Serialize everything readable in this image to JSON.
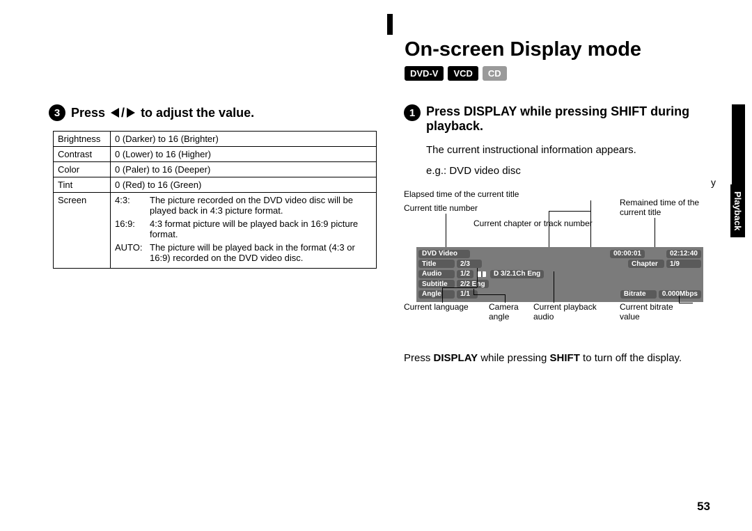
{
  "heading": "On-screen Display mode",
  "badges": {
    "dvd": "DVD-V",
    "vcd": "VCD",
    "cd": "CD"
  },
  "sideTab": "Playback",
  "pageNumber": "53",
  "left": {
    "stepNum": "3",
    "stepTextA": "Press",
    "stepTextB": "to adjust the value.",
    "rows": {
      "brightness_k": "Brightness",
      "brightness_v": "0 (Darker) to 16 (Brighter)",
      "contrast_k": "Contrast",
      "contrast_v": "0 (Lower) to 16 (Higher)",
      "color_k": "Color",
      "color_v": "0 (Paler) to 16 (Deeper)",
      "tint_k": "Tint",
      "tint_v": "0 (Red) to 16 (Green)",
      "screen_k": "Screen",
      "screen_43m": "4:3:",
      "screen_43v": "The picture recorded on the DVD video disc will be played back in 4:3 picture format.",
      "screen_169m": "16:9:",
      "screen_169v": "4:3 format picture will be played back in 16:9 picture format.",
      "screen_autom": "AUTO:",
      "screen_autov": "The picture will be played back in the format (4:3 or 16:9) recorded on the DVD video disc."
    }
  },
  "right": {
    "stepNum": "1",
    "stepText": "Press DISPLAY while pressing SHIFT during playback.",
    "para1": "The current instructional information appears.",
    "para2": "e.g.: DVD video disc",
    "willGo": "y",
    "callouts": {
      "ctn": "Current title number",
      "elapsed": "Elapsed time of the current title",
      "remained": "Remained time of the current title",
      "chap": "Current chapter or track number",
      "lang": "Current language",
      "angle": "Camera angle",
      "audio": "Current playback audio",
      "bitrate": "Current bitrate value"
    },
    "osd": {
      "disc": "DVD Video",
      "title_l": "Title",
      "title_v": "2/3",
      "chapter_l": "Chapter",
      "chapter_v": "1/9",
      "elapsed": "00:00:01",
      "remained": "02:12:40",
      "audio_l": "Audio",
      "audio_v1": "1/2",
      "audio_v2": "D 3/2.1Ch Eng",
      "sub_l": "Subtitle",
      "sub_v": "2/2 Eng",
      "angle_l": "Angle",
      "angle_v": "1/1",
      "bitrate_l": "Bitrate",
      "bitrate_v": "0.000Mbps"
    },
    "offA": "Press ",
    "offB": "DISPLAY",
    "offC": " while pressing ",
    "offD": "SHIFT",
    "offE": " to turn off the display."
  }
}
